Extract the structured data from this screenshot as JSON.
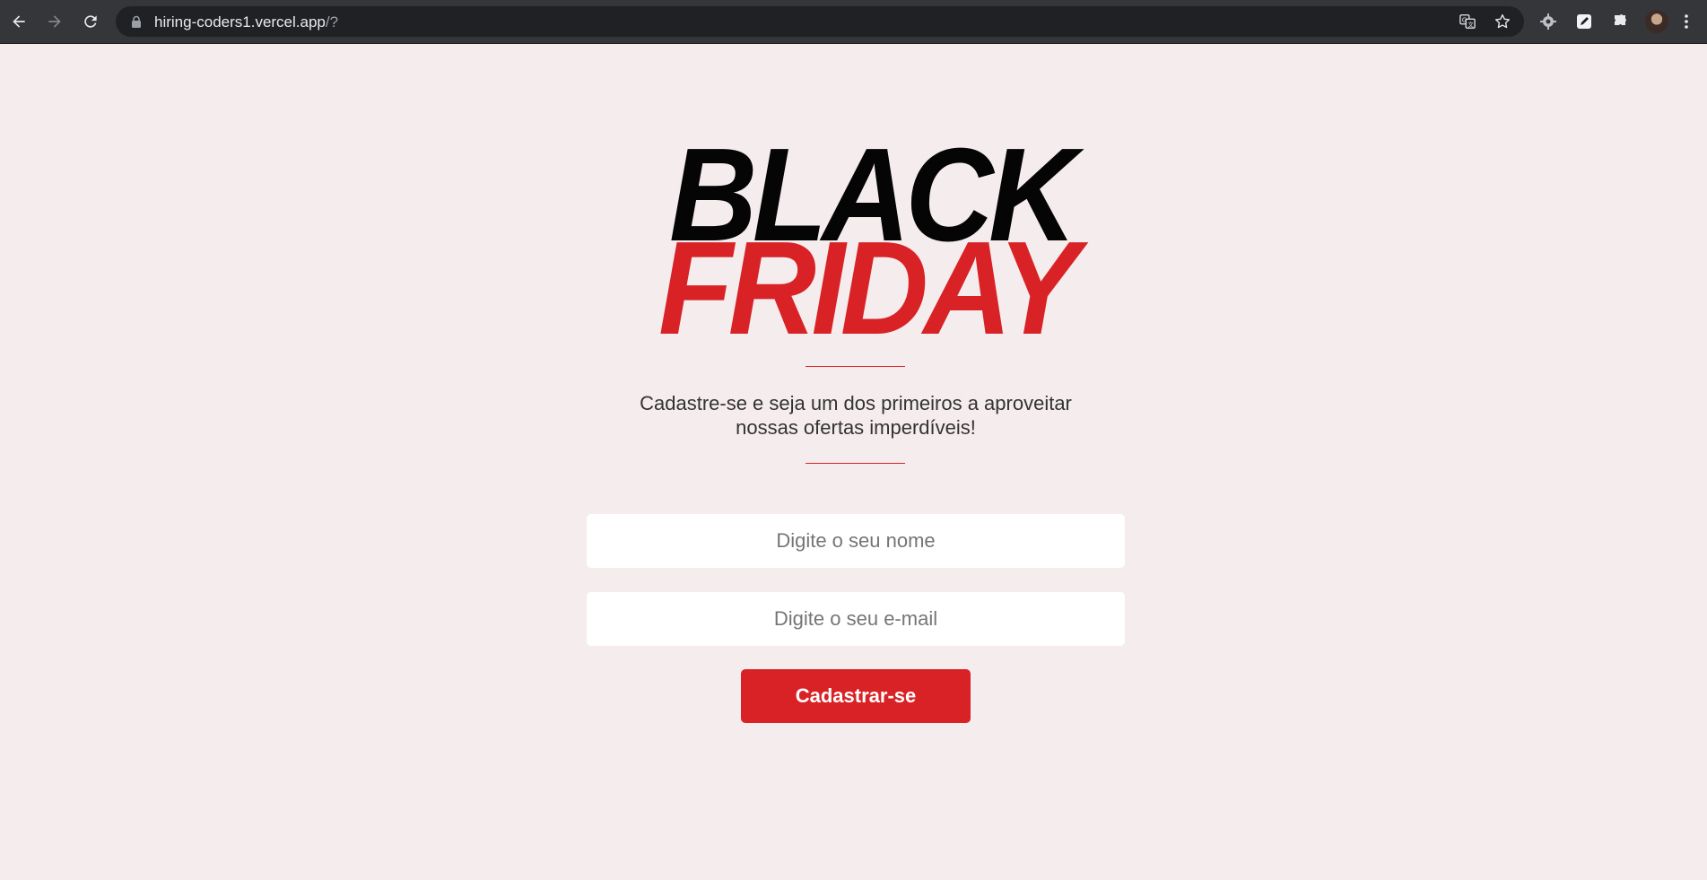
{
  "browser": {
    "url_host": "hiring-coders1.vercel.app",
    "url_path": "/?",
    "icons": {
      "back": "back-arrow-icon",
      "forward": "forward-arrow-icon",
      "reload": "reload-icon",
      "lock": "lock-icon",
      "translate": "translate-icon",
      "bookmark": "star-icon",
      "extensions": [
        "gear-extension-icon",
        "pen-extension-icon",
        "puzzle-extensions-icon"
      ],
      "menu": "kebab-menu-icon"
    }
  },
  "hero": {
    "logo_line1": "BLACK",
    "logo_line2": "FRIDAY",
    "tagline": "Cadastre-se e seja um dos primeiros a aproveitar nossas ofertas imperdíveis!"
  },
  "form": {
    "name_placeholder": "Digite o seu nome",
    "name_value": "",
    "email_placeholder": "Digite o seu e-mail",
    "email_value": "",
    "submit_label": "Cadastrar-se"
  },
  "colors": {
    "page_background": "#f5ecee",
    "brand_red": "#d92226",
    "logo_black": "#050505",
    "chrome_dark": "#35363a"
  }
}
